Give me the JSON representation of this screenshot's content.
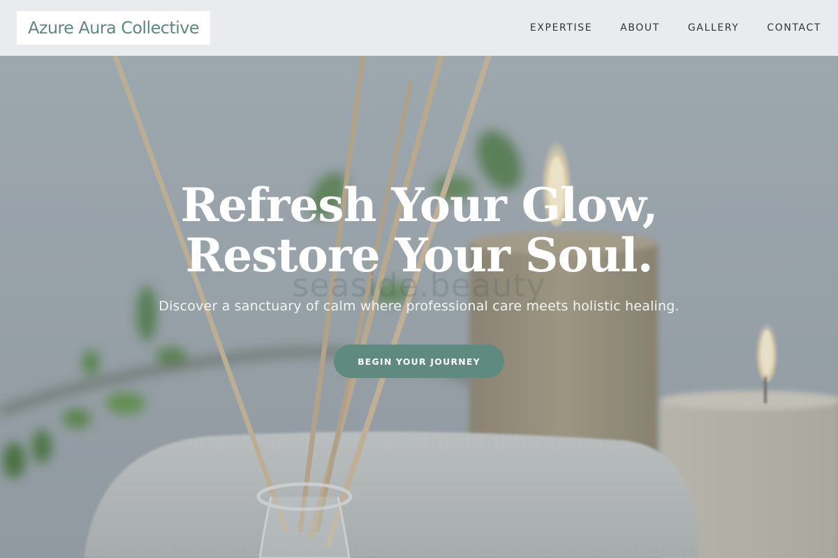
{
  "brand": {
    "name": "Azure Aura Collective",
    "color": "#5e8a80"
  },
  "nav": {
    "items": [
      {
        "label": "EXPERTISE"
      },
      {
        "label": "ABOUT"
      },
      {
        "label": "GALLERY"
      },
      {
        "label": "CONTACT"
      }
    ]
  },
  "hero": {
    "title_line1": "Refresh Your Glow,",
    "title_line2": "Restore Your Soul.",
    "subtitle": "Discover a sanctuary of calm where professional care meets holistic healing.",
    "watermark": "seaside.beauty",
    "cta_label": "BEGIN YOUR JOURNEY",
    "cta_color": "#5e8a80"
  },
  "background": {
    "image": "spa-scene",
    "objects": [
      "reed-diffuser",
      "candles",
      "towel",
      "green-leaves"
    ]
  }
}
